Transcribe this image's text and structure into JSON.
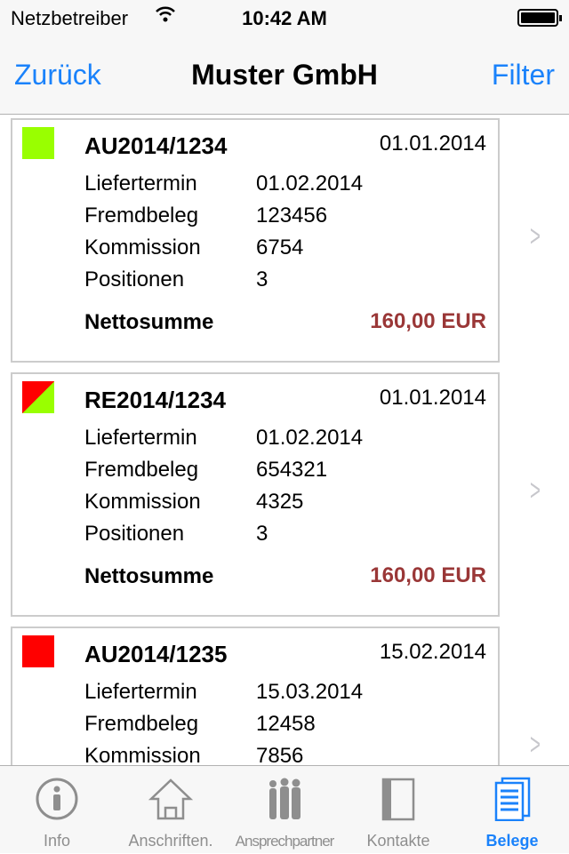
{
  "status": {
    "carrier": "Netzbetreiber",
    "time": "10:42 AM",
    "battery_level": 1.0
  },
  "nav": {
    "back": "Zurück",
    "title": "Muster GmbH",
    "filter": "Filter"
  },
  "labels": {
    "liefertermin": "Liefertermin",
    "fremdbeleg": "Fremdbeleg",
    "kommission": "Kommission",
    "positionen": "Positionen",
    "nettosumme": "Nettosumme"
  },
  "cards": [
    {
      "number": "AU2014/1234",
      "date": "01.01.2014",
      "liefertermin": "01.02.2014",
      "fremdbeleg": "123456",
      "kommission": "6754",
      "positionen": "3",
      "nettosumme": "160,00 EUR",
      "status_colors": [
        "#99ff00"
      ]
    },
    {
      "number": "RE2014/1234",
      "date": "01.01.2014",
      "liefertermin": "01.02.2014",
      "fremdbeleg": "654321",
      "kommission": "4325",
      "positionen": "3",
      "nettosumme": "160,00 EUR",
      "status_colors": [
        "#ff0000",
        "#99ff00"
      ]
    },
    {
      "number": "AU2014/1235",
      "date": "15.02.2014",
      "liefertermin": "15.03.2014",
      "fremdbeleg": "12458",
      "kommission": "7856",
      "status_colors": [
        "#ff0000"
      ]
    }
  ],
  "tabs": [
    {
      "label": "Info",
      "icon": "info-icon"
    },
    {
      "label": "Anschriften.",
      "icon": "house-icon"
    },
    {
      "label": "Ansprechpartner",
      "icon": "people-icon"
    },
    {
      "label": "Kontakte",
      "icon": "book-icon"
    },
    {
      "label": "Belege",
      "icon": "documents-icon",
      "active": true
    }
  ],
  "colors": {
    "accent": "#1a82fb",
    "amount": "#9a3737"
  }
}
